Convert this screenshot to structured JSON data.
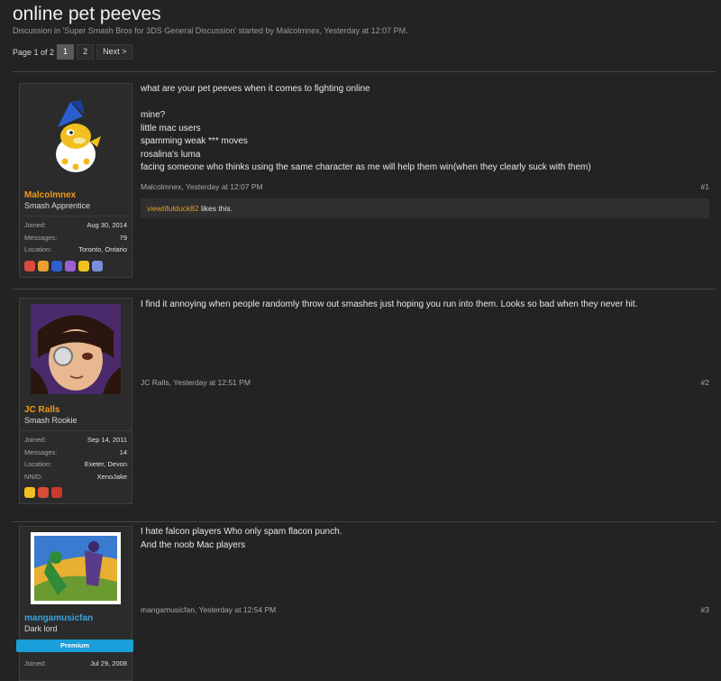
{
  "thread": {
    "title": "online pet peeves",
    "description": "Discussion in 'Super Smash Bros for 3DS General Discussion' started by Malcolmnex, Yesterday at 12:07 PM."
  },
  "pagenav": {
    "label": "Page 1 of 2",
    "pages": [
      "1",
      "2"
    ],
    "next": "Next >"
  },
  "posts": [
    {
      "user": {
        "name": "Malcolmnex",
        "title": "Smash Apprentice"
      },
      "stats": [
        {
          "k": "Joined:",
          "v": "Aug 30, 2014"
        },
        {
          "k": "Messages:",
          "v": "79"
        },
        {
          "k": "Location:",
          "v": "Toronto, Ontario"
        }
      ],
      "message": [
        "what are your pet peeves when it comes to fighting online",
        "",
        "mine?",
        "little mac users",
        "spamming weak *** moves",
        "rosalina's luma",
        "facing someone who thinks using the same character as me will help them win(when they clearly suck with them)"
      ],
      "meta": "Malcolmnex, Yesterday at 12:07 PM",
      "number": "#1",
      "likes": {
        "user": "viewtifulduck82",
        "text": " likes this."
      }
    },
    {
      "user": {
        "name": "JC Ralls",
        "title": "Smash Rookie"
      },
      "stats": [
        {
          "k": "Joined:",
          "v": "Sep 14, 2011"
        },
        {
          "k": "Messages:",
          "v": "14"
        },
        {
          "k": "Location:",
          "v": "Exeter, Devon"
        },
        {
          "k": "NNID:",
          "v": "XenoJake"
        }
      ],
      "message": [
        "I find it annoying when people randomly throw out smashes just hoping you run into them. Looks so bad when they never hit."
      ],
      "meta": "JC Ralls, Yesterday at 12:51 PM",
      "number": "#2"
    },
    {
      "user": {
        "name": "mangamusicfan",
        "title": "Dark lord",
        "badge": "Premium"
      },
      "stats": [
        {
          "k": "Joined:",
          "v": "Jul 29, 2008"
        }
      ],
      "message": [
        "I hate falcon players Who only spam flacon punch.",
        "And the noob Mac players"
      ],
      "meta": "mangamusicfan, Yesterday at 12:54 PM",
      "number": "#3"
    }
  ]
}
